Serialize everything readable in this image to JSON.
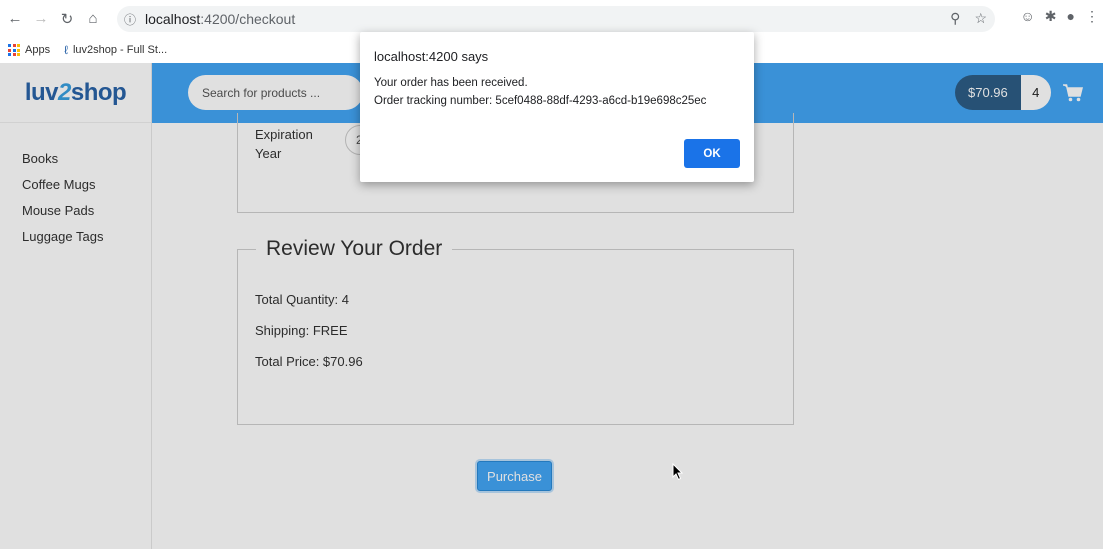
{
  "browser": {
    "url_host": "localhost",
    "url_rest": ":4200/checkout",
    "bookmarks": [
      {
        "label": "Apps"
      },
      {
        "label": "luv2shop - Full St..."
      }
    ]
  },
  "site": {
    "logo_left": "luv",
    "logo_mid": "2",
    "logo_right": "shop",
    "categories": [
      "Books",
      "Coffee Mugs",
      "Mouse Pads",
      "Luggage Tags"
    ],
    "search_placeholder": "Search for products ...",
    "cart_total": "$70.96",
    "cart_quantity": "4"
  },
  "checkout": {
    "expiration_label": "Expiration Year",
    "expiration_value": "2",
    "review_title": "Review Your Order",
    "total_quantity": "Total Quantity: 4",
    "shipping": "Shipping: FREE",
    "total_price": "Total Price: $70.96",
    "purchase_label": "Purchase"
  },
  "dialog": {
    "title": "localhost:4200 says",
    "line1": "Your order has been received.",
    "line2": "Order tracking number: 5cef0488-88df-4293-a6cd-b19e698c25ec",
    "ok_label": "OK"
  },
  "colors": {
    "header": "#42a5f5",
    "cart_total_bg": "#2d5d86",
    "dialog_button": "#1a73e8"
  }
}
